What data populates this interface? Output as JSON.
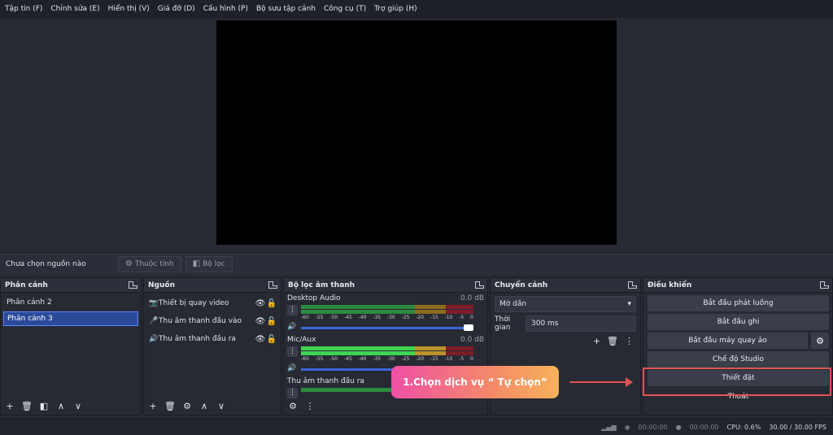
{
  "menu": [
    "Tập tin (F)",
    "Chỉnh sửa (E)",
    "Hiển thị (V)",
    "Giá đỡ (D)",
    "Cấu hình (P)",
    "Bộ sưu tập cảnh",
    "Công cụ (T)",
    "Trợ giúp (H)"
  ],
  "source_toolbar": {
    "no_source": "Chưa chọn nguồn nào",
    "properties": "Thuộc tính",
    "filters": "Bộ lọc"
  },
  "scenes": {
    "title": "Phân cảnh",
    "items": [
      "Phân cảnh 2",
      "Phân cảnh 3"
    ],
    "selected": "Phân cảnh 3"
  },
  "sources": {
    "title": "Nguồn",
    "items": [
      {
        "icon": "camera-icon",
        "name": "Thiết bị quay video"
      },
      {
        "icon": "microphone-icon",
        "name": "Thu âm thanh đầu vào"
      },
      {
        "icon": "speaker-icon",
        "name": "Thu âm thanh đầu ra"
      }
    ]
  },
  "mixer": {
    "title": "Bộ lọc âm thanh",
    "ticks": [
      "-60",
      "-55",
      "-50",
      "-45",
      "-40",
      "-35",
      "-30",
      "-25",
      "-20",
      "-15",
      "-10",
      "-5",
      "0"
    ],
    "channels": [
      {
        "name": "Desktop Audio",
        "db": "0.0 dB",
        "active": false
      },
      {
        "name": "Mic/Aux",
        "db": "0.0 dB",
        "active": true
      },
      {
        "name": "Thu âm thanh đầu ra",
        "db": "",
        "active": false
      }
    ]
  },
  "transitions": {
    "title": "Chuyển cảnh",
    "selected": "Mờ dần",
    "duration_label": "Thời gian",
    "duration": "300 ms"
  },
  "controls": {
    "title": "Điều khiển",
    "start_stream": "Bắt đầu phát luồng",
    "start_record": "Bắt đầu ghi",
    "start_virtual_cam": "Bắt đầu máy quay ảo",
    "studio_mode": "Chế độ Studio",
    "settings": "Thiết đặt",
    "exit": "Thoát"
  },
  "annotation": {
    "callout": "1.Chọn dịch vụ “ Tự chọn”",
    "color": "#e25454"
  },
  "status": {
    "stream_time": "00:00:00",
    "record_time": "00:00:00",
    "cpu": "CPU: 0.6%",
    "fps": "30.00 / 30.00 FPS"
  }
}
